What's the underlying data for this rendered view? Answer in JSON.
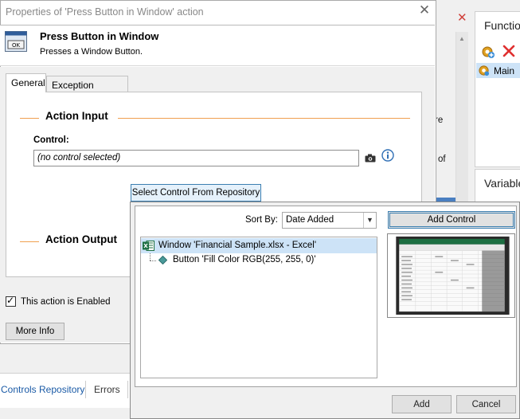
{
  "dialog": {
    "title": "Properties of 'Press Button in Window' action",
    "close_icon": "close-icon",
    "header": {
      "icon": "button-ok-icon",
      "title": "Press Button in Window",
      "description": "Presses a Window Button."
    },
    "tabs": [
      {
        "label": "General",
        "selected": true
      },
      {
        "label": "Exception Handling",
        "selected": false
      }
    ],
    "action_input_title": "Action Input",
    "control_label": "Control:",
    "control_value": "(no control selected)",
    "select_repo_label": "Select Control From Repository",
    "action_output_title": "Action Output",
    "enabled_checkbox": {
      "label": "This action is Enabled",
      "checked": true
    },
    "more_info_label": "More Info"
  },
  "bottom_tabs": [
    "Controls Repository",
    "Errors"
  ],
  "background_app": {
    "functions_title": "Function",
    "function_items": [
      "Main"
    ],
    "variables_title": "Variable",
    "partial_text_1": "re",
    "partial_text_2": "s of"
  },
  "repository_popup": {
    "sort_by_label": "Sort By:",
    "sort_by_value": "Date Added",
    "add_control_label": "Add Control",
    "tree": [
      {
        "label": "Window 'Financial Sample.xlsx - Excel'",
        "icon": "excel-icon",
        "selected": true
      },
      {
        "label": "Button 'Fill Color RGB(255, 255, 0)'",
        "icon": "diamond-icon",
        "selected": false
      }
    ],
    "add_label": "Add",
    "cancel_label": "Cancel"
  },
  "colors": {
    "accent_line": "#f0a050",
    "selection": "#cde3f7",
    "focus_border": "#3c7fb1",
    "link_blue": "#1a5aa6"
  }
}
